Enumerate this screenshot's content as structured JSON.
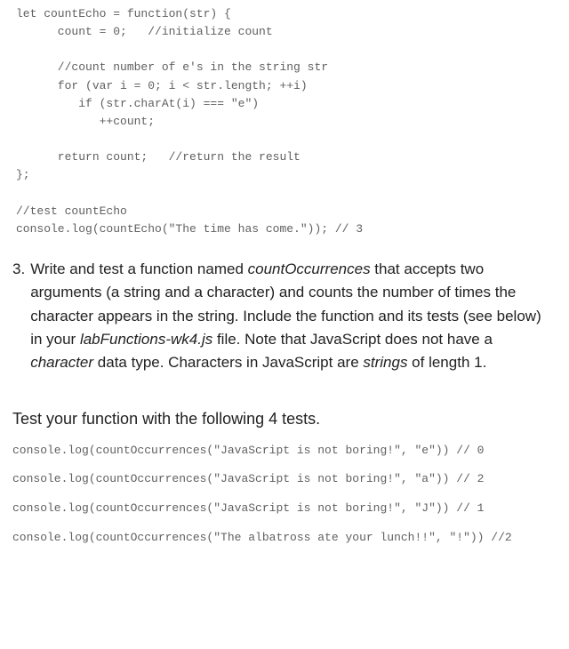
{
  "code_block": "let countEcho = function(str) {\n      count = 0;   //initialize count\n\n      //count number of e's in the string str\n      for (var i = 0; i < str.length; ++i)\n         if (str.charAt(i) === \"e\")\n            ++count;\n\n      return count;   //return the result\n};\n\n//test countEcho\nconsole.log(countEcho(\"The time has come.\")); // 3",
  "question": {
    "number": "3.",
    "parts": [
      {
        "t": "Write and test a function named ",
        "i": false
      },
      {
        "t": "countOccurrences",
        "i": true
      },
      {
        "t": " that accepts two arguments (a string and a character) and counts the number of times the character appears in the string. Include the function and its tests (see below) in your ",
        "i": false
      },
      {
        "t": "labFunctions-wk4.js",
        "i": true
      },
      {
        "t": " file. Note that JavaScript does not have a ",
        "i": false
      },
      {
        "t": "character",
        "i": true
      },
      {
        "t": " data type. Characters in JavaScript are ",
        "i": false
      },
      {
        "t": "strings",
        "i": true
      },
      {
        "t": " of length 1.",
        "i": false
      }
    ]
  },
  "tests_heading": "Test your function with the following 4 tests.",
  "tests": [
    "console.log(countOccurrences(\"JavaScript is not boring!\", \"e\")) // 0",
    "console.log(countOccurrences(\"JavaScript is not boring!\", \"a\")) // 2",
    "console.log(countOccurrences(\"JavaScript is not boring!\", \"J\")) // 1",
    "console.log(countOccurrences(\"The albatross ate your lunch!!\", \"!\")) //2"
  ]
}
